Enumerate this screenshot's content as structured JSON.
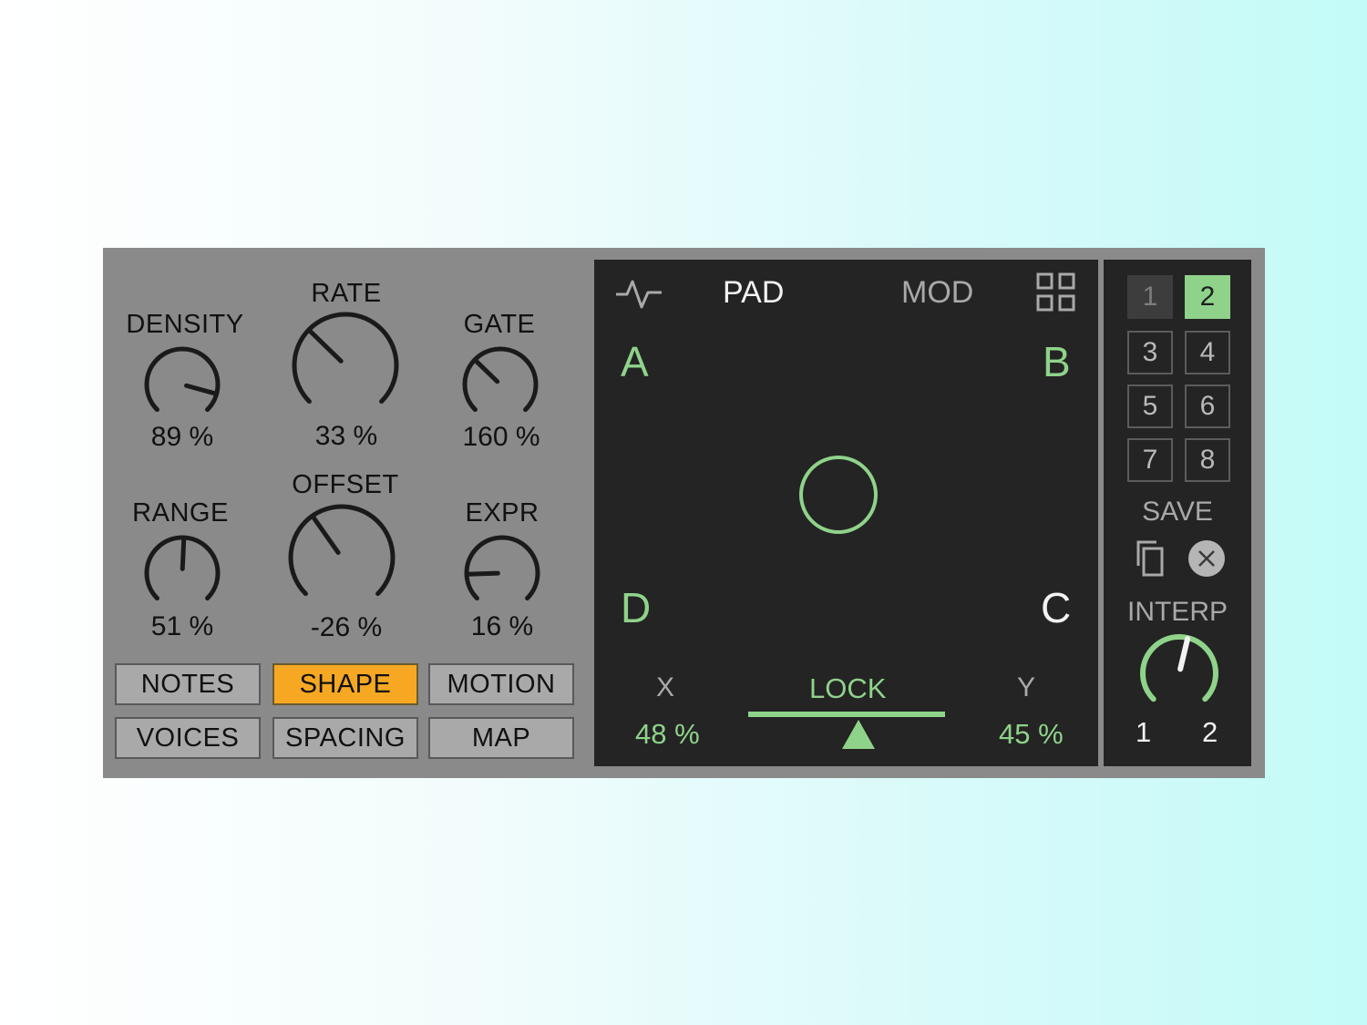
{
  "knobs": {
    "density": {
      "label": "DENSITY",
      "value": "89 %",
      "level": 0.89
    },
    "rate": {
      "label": "RATE",
      "value": "33 %",
      "level": 0.33
    },
    "gate": {
      "label": "GATE",
      "value": "160 %",
      "level": 0.33
    },
    "range": {
      "label": "RANGE",
      "value": "51 %",
      "level": 0.51
    },
    "offset": {
      "label": "OFFSET",
      "value": "-26 %",
      "level": 0.37
    },
    "expr": {
      "label": "EXPR",
      "value": "16 %",
      "level": 0.16
    }
  },
  "tabs": [
    {
      "label": "NOTES",
      "active": false
    },
    {
      "label": "SHAPE",
      "active": true
    },
    {
      "label": "MOTION",
      "active": false
    },
    {
      "label": "VOICES",
      "active": false
    },
    {
      "label": "SPACING",
      "active": false
    },
    {
      "label": "MAP",
      "active": false
    }
  ],
  "pad": {
    "tab_pad": "PAD",
    "tab_mod": "MOD",
    "icons": {
      "left": "waveform-icon",
      "right": "grid-icon"
    },
    "corners": {
      "a": "A",
      "b": "B",
      "c": "C",
      "d": "D"
    },
    "x_label": "X",
    "x_value": "48 %",
    "y_label": "Y",
    "y_value": "45 %",
    "lock_label": "LOCK"
  },
  "presets": {
    "slots": [
      "1",
      "2",
      "3",
      "4",
      "5",
      "6",
      "7",
      "8"
    ],
    "selected": "2",
    "save_label": "SAVE",
    "interp_label": "INTERP",
    "interp_min": "1",
    "interp_max": "2",
    "icons": {
      "copy": "copy-icon",
      "clear": "close-icon"
    }
  },
  "colors": {
    "panel": "#8a8a8a",
    "dark": "#242424",
    "accent_green": "#8fd38a",
    "accent_orange": "#f6a823"
  }
}
